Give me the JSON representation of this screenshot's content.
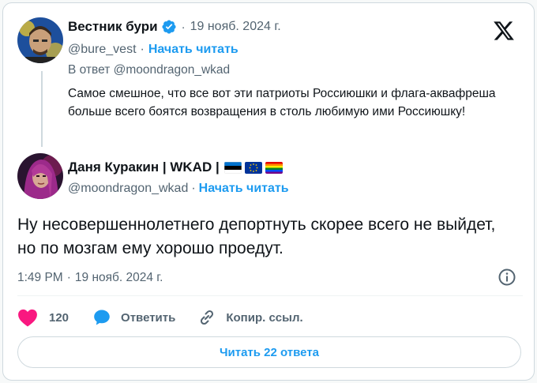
{
  "parent": {
    "display_name": "Вестник бури",
    "separator": "·",
    "date": "19 нояб. 2024 г.",
    "handle": "@bure_vest",
    "handle_separator": "·",
    "follow": "Начать читать",
    "reply_to": "В ответ @moondragon_wkad",
    "text": "Самое смешное, что все вот эти патриоты Россиюшки и флага-аквафреша больше всего боятся возвращения в столь любимую ими Россиюшку!"
  },
  "main": {
    "display_name": "Даня Куракин | WKAD |",
    "handle": "@moondragon_wkad",
    "handle_separator": "·",
    "follow": "Начать читать",
    "text": "Ну несовершеннолетнего депортнуть скорее всего не выйдет, но по мозгам ему хорошо проедут.",
    "time": "1:49 PM",
    "time_separator": "·",
    "date": "19 нояб. 2024 г."
  },
  "actions": {
    "likes": "120",
    "reply": "Ответить",
    "copy": "Копир. ссыл."
  },
  "read_replies": "Читать 22 ответа",
  "colors": {
    "accent": "#1d9bf0",
    "like": "#f91880",
    "muted": "#536471",
    "border": "#cfd9de"
  }
}
